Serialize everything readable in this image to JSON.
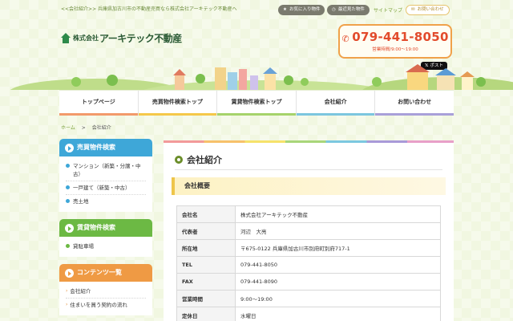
{
  "header": {
    "tagline": "<<会社紹介>> 兵庫県加古川市の不動産売買なら株式会社アーキテック不動産へ",
    "favorites_label": "お気に入り物件",
    "recent_label": "最近見た物件",
    "sitemap_label": "サイトマップ",
    "contact_label": "お問い合わせ",
    "logo_prefix": "株式会社",
    "logo_name": "アーキテック不動産",
    "phone": "079-441-8050",
    "hours": "営業時間/9:00～19:00",
    "post_label": "ポスト"
  },
  "nav": [
    {
      "label": "トップページ",
      "color": "#f29a6b"
    },
    {
      "label": "売買物件検索トップ",
      "color": "#f5c84a"
    },
    {
      "label": "賃貸物件検索トップ",
      "color": "#a6d36b"
    },
    {
      "label": "会社紹介",
      "color": "#7cc6df"
    },
    {
      "label": "お問い合わせ",
      "color": "#a9a0d9"
    }
  ],
  "breadcrumb": {
    "home": "ホーム",
    "separator": ">",
    "current": "会社紹介"
  },
  "sidebar": {
    "sale": {
      "title": "売買物件検索",
      "color": "#3ea7d8",
      "items": [
        "マンション（新築・分譲・中古）",
        "一戸建て（新築・中古）",
        "売土地"
      ]
    },
    "rent": {
      "title": "賃貸物件検索",
      "color": "#6cb944",
      "items": [
        "貸駐車場"
      ]
    },
    "contents": {
      "title": "コンテンツ一覧",
      "color": "#ef9a44",
      "items": [
        "会社紹介",
        "住まいを買う契約の流れ"
      ]
    }
  },
  "main": {
    "title": "会社紹介",
    "section": "会社概要",
    "rows": [
      {
        "key": "会社名",
        "value": "株式会社アーキテック不動産"
      },
      {
        "key": "代表者",
        "value": "河辺　大亮"
      },
      {
        "key": "所在地",
        "value": "〒675-0122 兵庫県加古川市別府町別府717-1"
      },
      {
        "key": "TEL",
        "value": "079-441-8050"
      },
      {
        "key": "FAX",
        "value": "079-441-8090"
      },
      {
        "key": "営業時間",
        "value": "9:00～19:00"
      },
      {
        "key": "定休日",
        "value": "水曜日"
      }
    ]
  }
}
